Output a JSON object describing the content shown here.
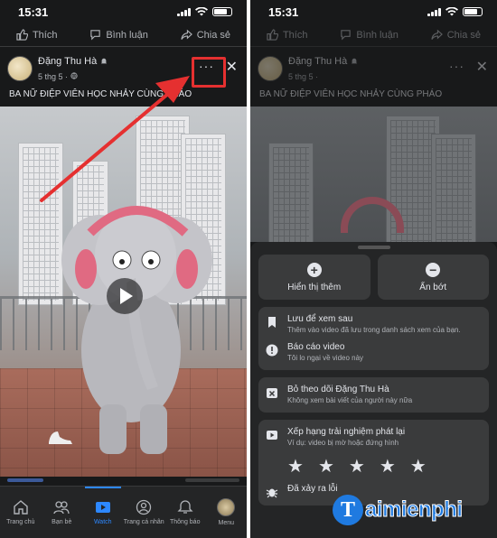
{
  "status": {
    "time": "15:31"
  },
  "actions": [
    {
      "icon": "like-icon",
      "label": "Thích"
    },
    {
      "icon": "comment-icon",
      "label": "Bình luận"
    },
    {
      "icon": "share-icon",
      "label": "Chia sẻ"
    }
  ],
  "post": {
    "author": "Đặng Thu Hà",
    "meta": "5 thg 5 · ",
    "caption": "BA NỮ ĐIỆP VIÊN HỌC NHẢY CÙNG PHÁO",
    "more_label": "···",
    "close_label": "✕"
  },
  "tabbar": [
    {
      "icon": "home-icon",
      "label": "Trang chủ",
      "active": false
    },
    {
      "icon": "friends-icon",
      "label": "Bạn bè",
      "active": false
    },
    {
      "icon": "watch-icon",
      "label": "Watch",
      "active": true
    },
    {
      "icon": "profile-icon",
      "label": "Trang cá nhân",
      "active": false
    },
    {
      "icon": "bell-icon",
      "label": "Thông báo",
      "active": false
    },
    {
      "icon": "menu-avatar",
      "label": "Menu",
      "active": false
    }
  ],
  "sheet": {
    "show_more": "Hiển thị thêm",
    "show_less": "Ẩn bớt",
    "save_title": "Lưu để xem sau",
    "save_sub": "Thêm vào video đã lưu trong danh sách xem của bạn.",
    "report_title": "Báo cáo video",
    "report_sub": "Tôi lo ngại về video này",
    "unfollow_title": "Bỏ theo dõi Đặng Thu Hà",
    "unfollow_sub": "Không xem bài viết của người này nữa",
    "rate_title": "Xếp hạng trải nghiệm phát lại",
    "rate_sub": "Ví dụ: video bị mờ hoặc đứng hình",
    "stars": [
      "★",
      "★",
      "★",
      "★",
      "★"
    ],
    "issue_title": "Đã xảy ra lỗi"
  },
  "watermark": {
    "letter": "T",
    "text": "aimienphi"
  },
  "colors": {
    "accent": "#2d88ff",
    "highlight": "#e53030",
    "sheet": "#242526"
  }
}
